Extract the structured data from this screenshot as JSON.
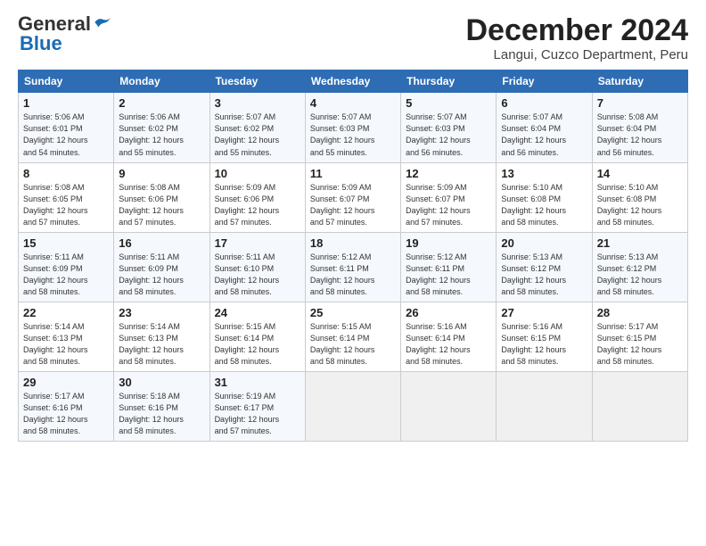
{
  "logo": {
    "general": "General",
    "blue": "Blue"
  },
  "title": "December 2024",
  "subtitle": "Langui, Cuzco Department, Peru",
  "weekdays": [
    "Sunday",
    "Monday",
    "Tuesday",
    "Wednesday",
    "Thursday",
    "Friday",
    "Saturday"
  ],
  "weeks": [
    [
      {
        "day": "1",
        "sunrise": "5:06 AM",
        "sunset": "6:01 PM",
        "daylight": "12 hours and 54 minutes."
      },
      {
        "day": "2",
        "sunrise": "5:06 AM",
        "sunset": "6:02 PM",
        "daylight": "12 hours and 55 minutes."
      },
      {
        "day": "3",
        "sunrise": "5:07 AM",
        "sunset": "6:02 PM",
        "daylight": "12 hours and 55 minutes."
      },
      {
        "day": "4",
        "sunrise": "5:07 AM",
        "sunset": "6:03 PM",
        "daylight": "12 hours and 55 minutes."
      },
      {
        "day": "5",
        "sunrise": "5:07 AM",
        "sunset": "6:03 PM",
        "daylight": "12 hours and 56 minutes."
      },
      {
        "day": "6",
        "sunrise": "5:07 AM",
        "sunset": "6:04 PM",
        "daylight": "12 hours and 56 minutes."
      },
      {
        "day": "7",
        "sunrise": "5:08 AM",
        "sunset": "6:04 PM",
        "daylight": "12 hours and 56 minutes."
      }
    ],
    [
      {
        "day": "8",
        "sunrise": "5:08 AM",
        "sunset": "6:05 PM",
        "daylight": "12 hours and 57 minutes."
      },
      {
        "day": "9",
        "sunrise": "5:08 AM",
        "sunset": "6:06 PM",
        "daylight": "12 hours and 57 minutes."
      },
      {
        "day": "10",
        "sunrise": "5:09 AM",
        "sunset": "6:06 PM",
        "daylight": "12 hours and 57 minutes."
      },
      {
        "day": "11",
        "sunrise": "5:09 AM",
        "sunset": "6:07 PM",
        "daylight": "12 hours and 57 minutes."
      },
      {
        "day": "12",
        "sunrise": "5:09 AM",
        "sunset": "6:07 PM",
        "daylight": "12 hours and 57 minutes."
      },
      {
        "day": "13",
        "sunrise": "5:10 AM",
        "sunset": "6:08 PM",
        "daylight": "12 hours and 58 minutes."
      },
      {
        "day": "14",
        "sunrise": "5:10 AM",
        "sunset": "6:08 PM",
        "daylight": "12 hours and 58 minutes."
      }
    ],
    [
      {
        "day": "15",
        "sunrise": "5:11 AM",
        "sunset": "6:09 PM",
        "daylight": "12 hours and 58 minutes."
      },
      {
        "day": "16",
        "sunrise": "5:11 AM",
        "sunset": "6:09 PM",
        "daylight": "12 hours and 58 minutes."
      },
      {
        "day": "17",
        "sunrise": "5:11 AM",
        "sunset": "6:10 PM",
        "daylight": "12 hours and 58 minutes."
      },
      {
        "day": "18",
        "sunrise": "5:12 AM",
        "sunset": "6:11 PM",
        "daylight": "12 hours and 58 minutes."
      },
      {
        "day": "19",
        "sunrise": "5:12 AM",
        "sunset": "6:11 PM",
        "daylight": "12 hours and 58 minutes."
      },
      {
        "day": "20",
        "sunrise": "5:13 AM",
        "sunset": "6:12 PM",
        "daylight": "12 hours and 58 minutes."
      },
      {
        "day": "21",
        "sunrise": "5:13 AM",
        "sunset": "6:12 PM",
        "daylight": "12 hours and 58 minutes."
      }
    ],
    [
      {
        "day": "22",
        "sunrise": "5:14 AM",
        "sunset": "6:13 PM",
        "daylight": "12 hours and 58 minutes."
      },
      {
        "day": "23",
        "sunrise": "5:14 AM",
        "sunset": "6:13 PM",
        "daylight": "12 hours and 58 minutes."
      },
      {
        "day": "24",
        "sunrise": "5:15 AM",
        "sunset": "6:14 PM",
        "daylight": "12 hours and 58 minutes."
      },
      {
        "day": "25",
        "sunrise": "5:15 AM",
        "sunset": "6:14 PM",
        "daylight": "12 hours and 58 minutes."
      },
      {
        "day": "26",
        "sunrise": "5:16 AM",
        "sunset": "6:14 PM",
        "daylight": "12 hours and 58 minutes."
      },
      {
        "day": "27",
        "sunrise": "5:16 AM",
        "sunset": "6:15 PM",
        "daylight": "12 hours and 58 minutes."
      },
      {
        "day": "28",
        "sunrise": "5:17 AM",
        "sunset": "6:15 PM",
        "daylight": "12 hours and 58 minutes."
      }
    ],
    [
      {
        "day": "29",
        "sunrise": "5:17 AM",
        "sunset": "6:16 PM",
        "daylight": "12 hours and 58 minutes."
      },
      {
        "day": "30",
        "sunrise": "5:18 AM",
        "sunset": "6:16 PM",
        "daylight": "12 hours and 58 minutes."
      },
      {
        "day": "31",
        "sunrise": "5:19 AM",
        "sunset": "6:17 PM",
        "daylight": "12 hours and 57 minutes."
      },
      null,
      null,
      null,
      null
    ]
  ]
}
